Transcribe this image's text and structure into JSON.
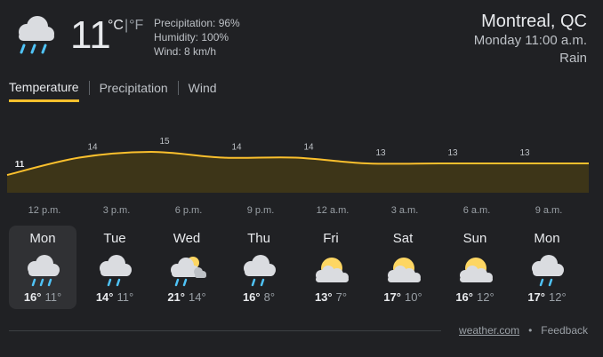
{
  "current": {
    "icon": "rain-cloud-icon",
    "temperature": "11",
    "unit_c": "°C",
    "unit_sep": "|",
    "unit_f": "°F",
    "precipitation": "Precipitation: 96%",
    "humidity": "Humidity: 100%",
    "wind": "Wind: 8 km/h"
  },
  "location": {
    "city": "Montreal, QC",
    "time": "Monday 11:00 a.m.",
    "condition": "Rain"
  },
  "tabs": [
    {
      "label": "Temperature",
      "active": true
    },
    {
      "label": "Precipitation",
      "active": false
    },
    {
      "label": "Wind",
      "active": false
    }
  ],
  "chart_data": {
    "type": "area",
    "x": [
      "12 p.m.",
      "3 p.m.",
      "6 p.m.",
      "9 p.m.",
      "12 a.m.",
      "3 a.m.",
      "6 a.m.",
      "9 a.m."
    ],
    "values": [
      11,
      14,
      15,
      14,
      14,
      13,
      13,
      13
    ],
    "labels": [
      "11",
      "14",
      "15",
      "14",
      "14",
      "13",
      "13",
      "13"
    ],
    "fill_color": "#3d3518",
    "line_color": "#fbc02d"
  },
  "forecast": [
    {
      "day": "Mon",
      "icon": "rain-cloud-icon",
      "hi": "16°",
      "lo": "11°",
      "selected": true
    },
    {
      "day": "Tue",
      "icon": "rain-cloud-icon",
      "hi": "14°",
      "lo": "11°",
      "selected": false
    },
    {
      "day": "Wed",
      "icon": "sun-cloud-rain-icon",
      "hi": "21°",
      "lo": "14°",
      "selected": false
    },
    {
      "day": "Thu",
      "icon": "rain-cloud-icon",
      "hi": "16°",
      "lo": "8°",
      "selected": false
    },
    {
      "day": "Fri",
      "icon": "partly-cloudy-icon",
      "hi": "13°",
      "lo": "7°",
      "selected": false
    },
    {
      "day": "Sat",
      "icon": "partly-cloudy-icon",
      "hi": "17°",
      "lo": "10°",
      "selected": false
    },
    {
      "day": "Sun",
      "icon": "partly-cloudy-icon",
      "hi": "16°",
      "lo": "12°",
      "selected": false
    },
    {
      "day": "Mon",
      "icon": "rain-cloud-icon",
      "hi": "17°",
      "lo": "12°",
      "selected": false
    }
  ],
  "footer": {
    "source": "weather.com",
    "separator": "•",
    "feedback": "Feedback"
  }
}
